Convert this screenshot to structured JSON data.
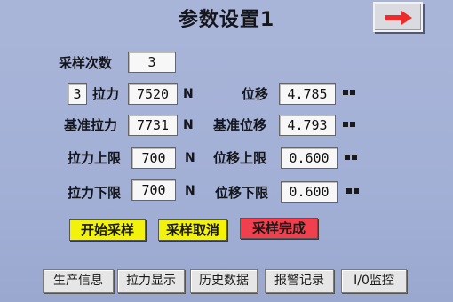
{
  "screen": {
    "title": "参数设置1",
    "next_page_icon": "arrow-right-icon",
    "sample_count": {
      "label": "采样次数",
      "value": "3"
    },
    "force_row": {
      "index": "3",
      "label": "拉力",
      "value": "7520",
      "unit": "N",
      "disp_label": "位移",
      "disp_value": "4.785"
    },
    "ref_row": {
      "label": "基准拉力",
      "value": "7731",
      "unit": "N",
      "disp_label": "基准位移",
      "disp_value": "4.793"
    },
    "upper_row": {
      "label": "拉力上限",
      "value": "700",
      "unit": "N",
      "disp_label": "位移上限",
      "disp_value": "0.600"
    },
    "lower_row": {
      "label": "拉力下限",
      "value": "700",
      "unit": "N",
      "disp_label": "位移下限",
      "disp_value": "0.600"
    },
    "actions": {
      "start": "开始采样",
      "cancel": "采样取消",
      "done": "采样完成"
    },
    "tabs": [
      "生产信息",
      "拉力显示",
      "历史数据",
      "报警记录",
      "I/0监控"
    ],
    "colors": {
      "background": "#a5b2d7",
      "start_button": "#f2f20a",
      "cancel_button": "#f2f20a",
      "done_button": "#f0404e",
      "arrow": "#ee2b2b"
    }
  }
}
